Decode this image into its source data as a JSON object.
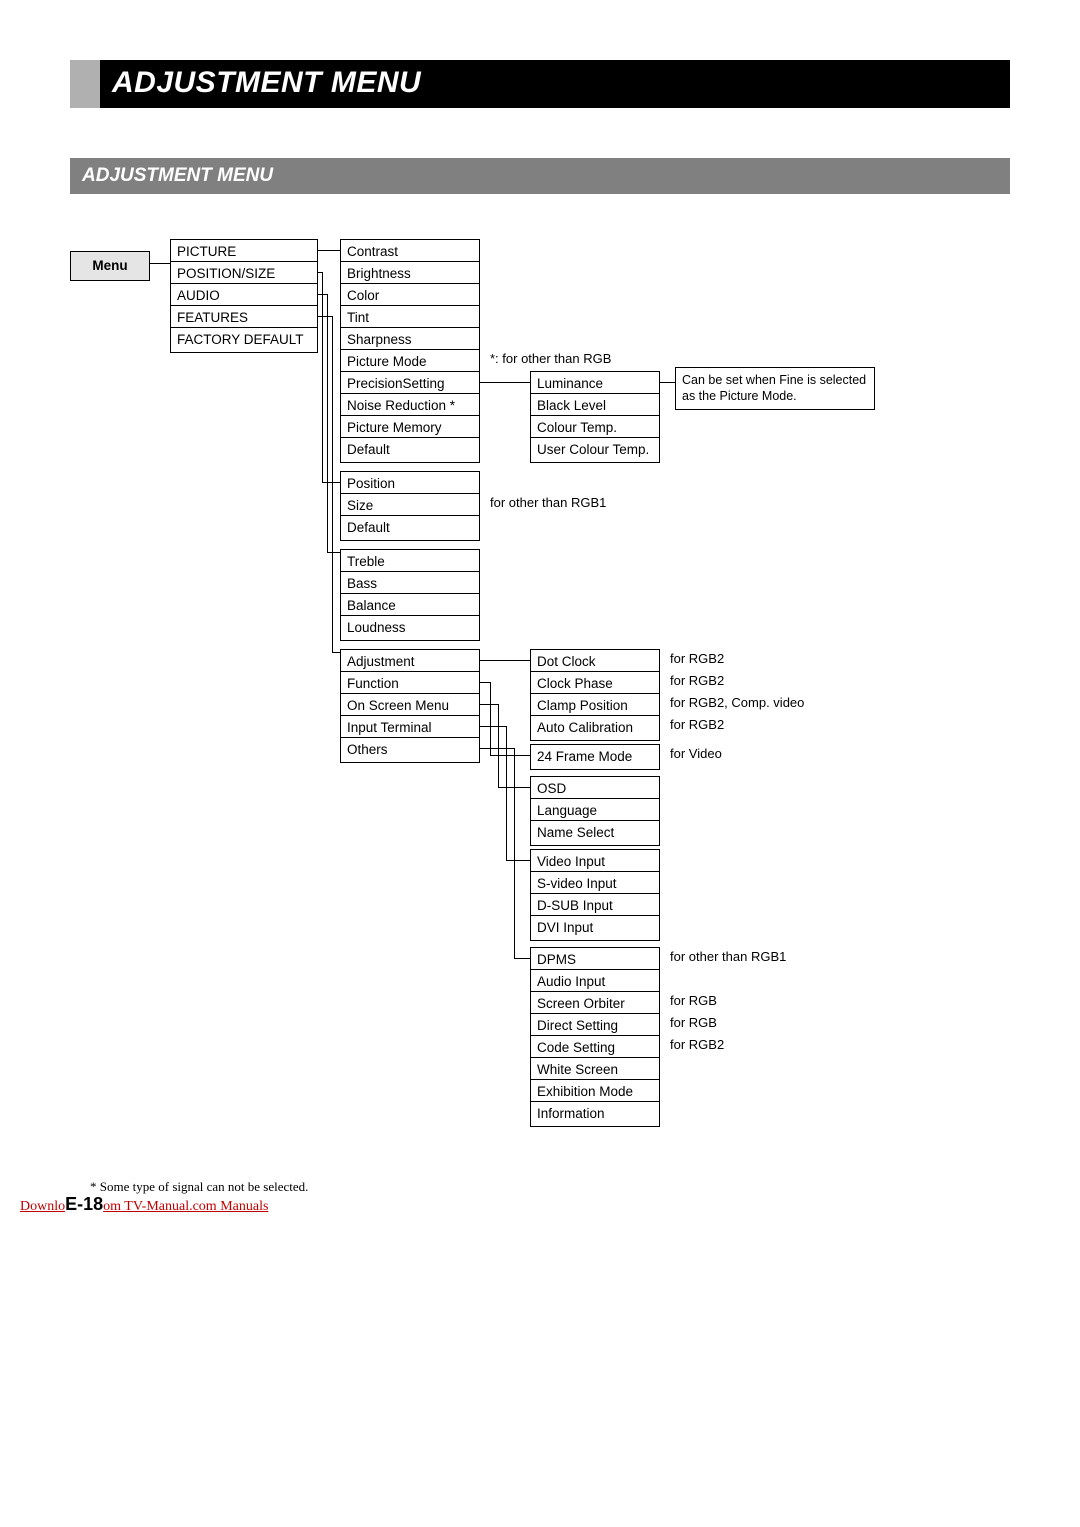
{
  "title": "ADJUSTMENT MENU",
  "section": "ADJUSTMENT MENU",
  "menu_label": "Menu",
  "level1": {
    "picture": "PICTURE",
    "position_size": "POSITION/SIZE",
    "audio": "AUDIO",
    "features": "FEATURES",
    "factory_default": "FACTORY DEFAULT"
  },
  "picture_sub": {
    "contrast": "Contrast",
    "brightness": "Brightness",
    "color": "Color",
    "tint": "Tint",
    "sharpness": "Sharpness",
    "picture_mode": "Picture Mode",
    "precision_setting": "PrecisionSetting",
    "noise_reduction": "Noise Reduction *",
    "picture_memory": "Picture Memory",
    "default": "Default"
  },
  "precision_sub": {
    "luminance": "Luminance",
    "black_level": "Black Level",
    "colour_temp": "Colour Temp.",
    "user_colour_temp": "User Colour Temp."
  },
  "position_sub": {
    "position": "Position",
    "size": "Size",
    "default": "Default"
  },
  "audio_sub": {
    "treble": "Treble",
    "bass": "Bass",
    "balance": "Balance",
    "loudness": "Loudness"
  },
  "features_sub": {
    "adjustment": "Adjustment",
    "function": "Function",
    "on_screen_menu": "On Screen Menu",
    "input_terminal": "Input Terminal",
    "others": "Others"
  },
  "adjustment_sub": {
    "dot_clock": "Dot Clock",
    "clock_phase": "Clock Phase",
    "clamp_position": "Clamp Position",
    "auto_calibration": "Auto Calibration"
  },
  "function_sub": {
    "frame_mode": "24 Frame Mode"
  },
  "osm_sub": {
    "osd": "OSD",
    "language": "Language",
    "name_select": "Name Select"
  },
  "input_sub": {
    "video_input": "Video Input",
    "svideo_input": "S-video Input",
    "dsub_input": "D-SUB Input",
    "dvi_input": "DVI Input"
  },
  "others_sub": {
    "dpms": "DPMS",
    "audio_input": "Audio Input",
    "screen_orbiter": "Screen Orbiter",
    "direct_setting": "Direct Setting",
    "code_setting": "Code Setting",
    "white_screen": "White Screen",
    "exhibition_mode": "Exhibition Mode",
    "information": "Information"
  },
  "notes": {
    "other_than_rgb": "*: for other than RGB",
    "fine_mode": "Can be set when Fine is selected as the Picture Mode.",
    "other_than_rgb1_a": "for other than RGB1",
    "for_rgb2_a": "for RGB2",
    "for_rgb2_b": "for RGB2",
    "for_rgb2_comp": "for RGB2, Comp. video",
    "for_rgb2_c": "for RGB2",
    "for_video": "for Video",
    "other_than_rgb1_b": "for other than RGB1",
    "for_rgb_a": "for RGB",
    "for_rgb_b": "for RGB",
    "for_rgb2_d": "for RGB2"
  },
  "footnote": "* Some type of signal can not be selected.",
  "download_prefix": "Downlo",
  "download_suffix": "om TV-Manual.com Manuals",
  "page_number": "E-18"
}
